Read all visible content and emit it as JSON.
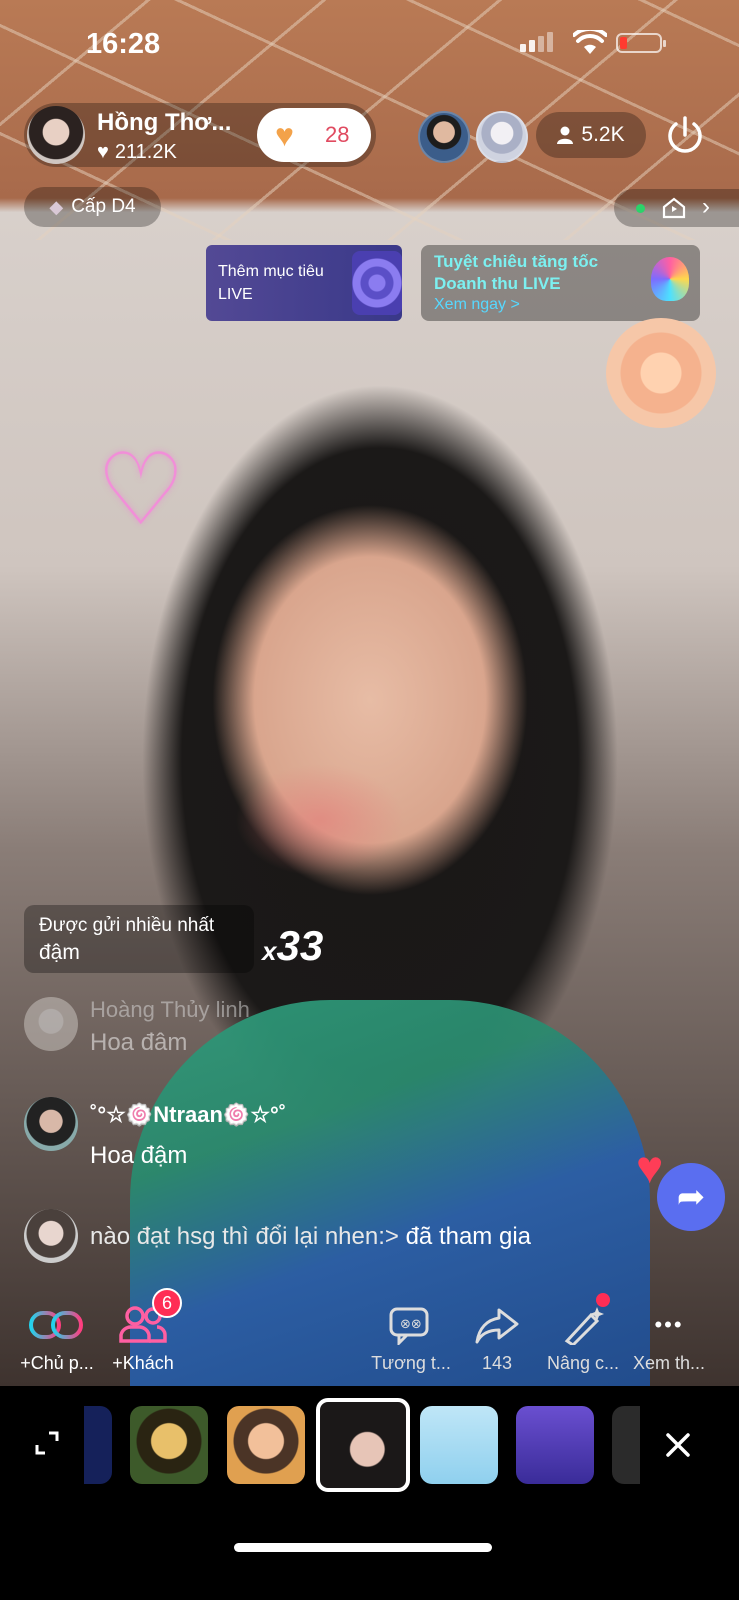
{
  "status_bar": {
    "time": "16:28"
  },
  "host": {
    "name": "Hồng Thơ...",
    "likes": "211.2K"
  },
  "gift_counter": {
    "count": "28"
  },
  "viewers": {
    "count": "5.2K"
  },
  "level": {
    "label": "Cấp D4"
  },
  "goal_banner": {
    "label": "Thêm mục tiêu LIVE"
  },
  "boost_banner": {
    "line1": "Tuyệt chiêu tăng tốc",
    "line2": "Doanh thu LIVE",
    "link": "Xem ngay >"
  },
  "top_gift": {
    "label": "Được gửi nhiều nhất",
    "name": "đậm",
    "combo_prefix": "x",
    "combo_count": "33"
  },
  "comments": [
    {
      "user": "Hoàng Thủy linh",
      "text": "Hoa đâm"
    },
    {
      "user": "˚°☆🍥Ntraan🍥☆°˚",
      "text": "Hoa đậm"
    },
    {
      "user": "nào đạt hsg thì đổi lại nhen:>",
      "text": "đã tham gia"
    }
  ],
  "toolbar": {
    "cohost": "+Chủ p...",
    "guests": "+Khách",
    "guests_badge": "6",
    "interact": "Tương t...",
    "share_count": "143",
    "enhance": "Nâng c...",
    "more": "Xem th..."
  },
  "colors": {
    "accent": "#ff2d55",
    "share_blue": "#5a6ef0",
    "banner_text": "#7cf0f0"
  }
}
